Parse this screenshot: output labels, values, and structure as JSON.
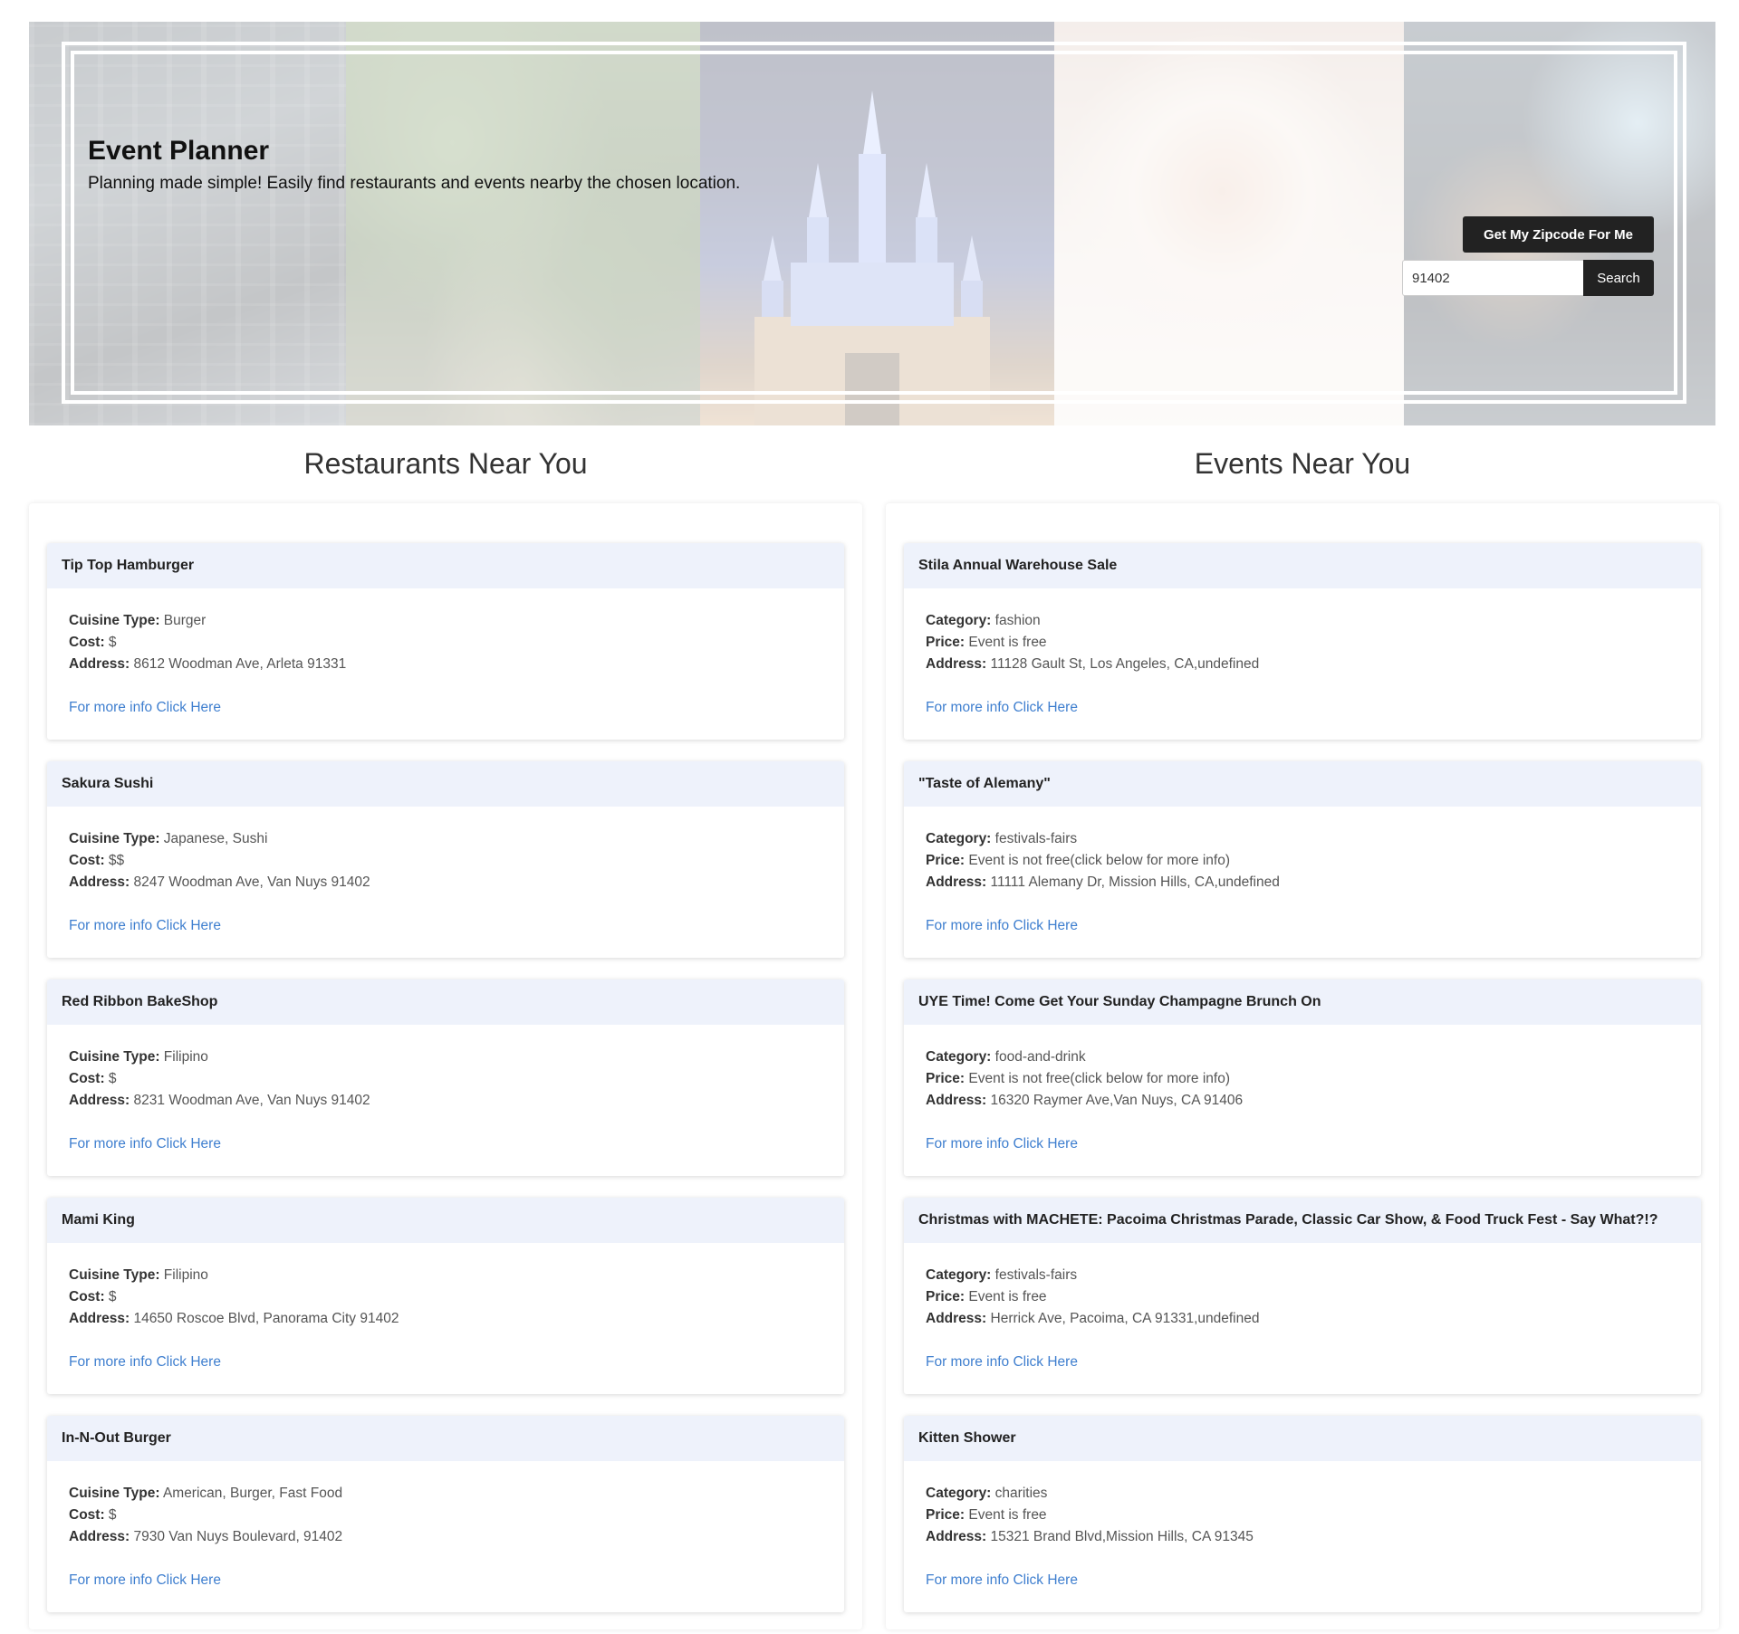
{
  "hero": {
    "title": "Event Planner",
    "subtitle": "Planning made simple! Easily find restaurants and events nearby the chosen location.",
    "zip_button": "Get My Zipcode For Me",
    "zip_value": "91402",
    "search_button": "Search"
  },
  "restaurants": {
    "heading": "Restaurants Near You",
    "field_labels": {
      "cuisine": "Cuisine Type:",
      "cost": "Cost:",
      "address": "Address:"
    },
    "link_text": "For more info Click Here",
    "items": [
      {
        "name": "Tip Top Hamburger",
        "cuisine": "Burger",
        "cost": "$",
        "address": "8612 Woodman Ave, Arleta 91331"
      },
      {
        "name": "Sakura Sushi",
        "cuisine": "Japanese, Sushi",
        "cost": "$$",
        "address": "8247 Woodman Ave, Van Nuys 91402"
      },
      {
        "name": "Red Ribbon BakeShop",
        "cuisine": "Filipino",
        "cost": "$",
        "address": "8231 Woodman Ave, Van Nuys 91402"
      },
      {
        "name": "Mami King",
        "cuisine": "Filipino",
        "cost": "$",
        "address": "14650 Roscoe Blvd, Panorama City 91402"
      },
      {
        "name": "In-N-Out Burger",
        "cuisine": "American, Burger, Fast Food",
        "cost": "$",
        "address": "7930 Van Nuys Boulevard, 91402"
      }
    ]
  },
  "events": {
    "heading": "Events Near You",
    "field_labels": {
      "category": "Category:",
      "price": "Price:",
      "address": "Address:"
    },
    "link_text": "For more info Click Here",
    "items": [
      {
        "name": "Stila Annual Warehouse Sale",
        "category": "fashion",
        "price": "Event is free",
        "address": "11128 Gault St, Los Angeles, CA,undefined"
      },
      {
        "name": "\"Taste of Alemany\"",
        "category": "festivals-fairs",
        "price": "Event is not free(click below for more info)",
        "address": "11111 Alemany Dr, Mission Hills, CA,undefined"
      },
      {
        "name": "UYE Time! Come Get Your Sunday Champagne Brunch On",
        "category": "food-and-drink",
        "price": "Event is not free(click below for more info)",
        "address": "16320 Raymer Ave,Van Nuys, CA 91406"
      },
      {
        "name": "Christmas with MACHETE: Pacoima Christmas Parade, Classic Car Show, & Food Truck Fest - Say What?!?",
        "category": "festivals-fairs",
        "price": "Event is free",
        "address": "Herrick Ave, Pacoima, CA 91331,undefined"
      },
      {
        "name": "Kitten Shower",
        "category": "charities",
        "price": "Event is free",
        "address": "15321 Brand Blvd,Mission Hills, CA 91345"
      }
    ]
  }
}
